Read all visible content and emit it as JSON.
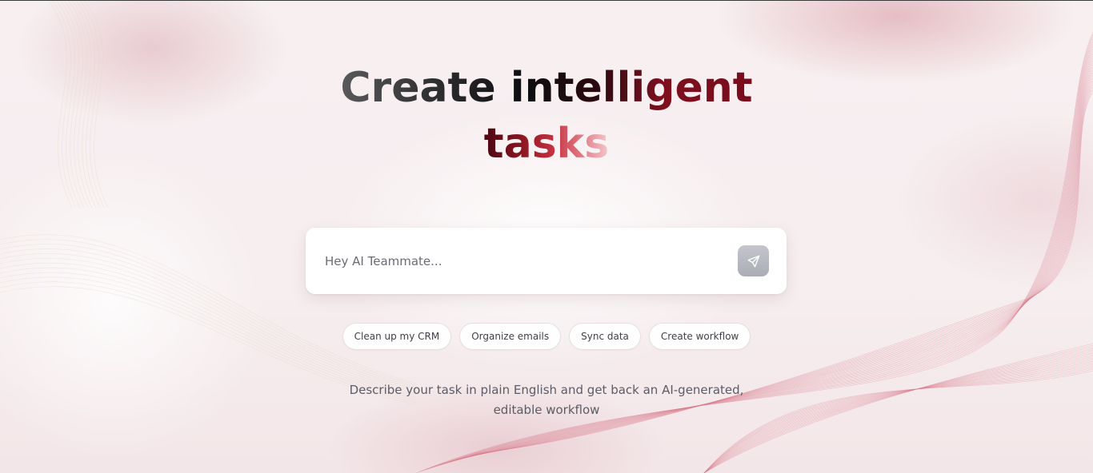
{
  "hero": {
    "title_line1": "Create intelligent",
    "title_line2": "tasks"
  },
  "prompt": {
    "placeholder": "Hey AI Teammate...",
    "value": "",
    "send_icon": "send-icon"
  },
  "suggestions": [
    {
      "label": "Clean up my CRM"
    },
    {
      "label": "Organize emails"
    },
    {
      "label": "Sync data"
    },
    {
      "label": "Create workflow"
    }
  ],
  "description": {
    "line1": "Describe your task in plain English and get back an AI-generated,",
    "line2": "editable workflow"
  },
  "colors": {
    "accent_dark": "#7a0b1c",
    "accent_light": "#e07a85",
    "background": "#f8f1f2"
  }
}
